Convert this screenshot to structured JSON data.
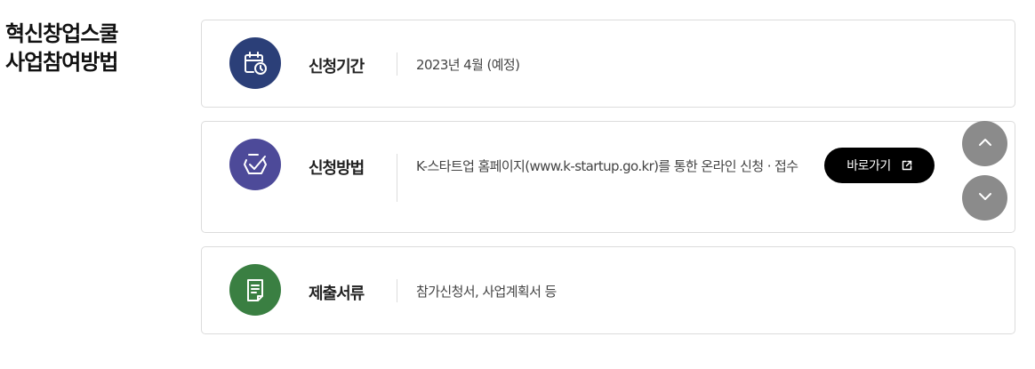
{
  "section_title": "혁신창업스쿨\n사업참여방법",
  "cards": [
    {
      "icon": "calendar-clock-icon",
      "label": "신청기간",
      "content": "2023년 4월 (예정)",
      "icon_bg": "#2b3f78"
    },
    {
      "icon": "check-badge-icon",
      "label": "신청방법",
      "content": "K-스타트업 홈페이지(www.k-startup.go.kr)를 통한 온라인 신청 · 접수",
      "icon_bg": "#4d4a99",
      "button_label": "바로가기",
      "button_icon": "external-link-icon"
    },
    {
      "icon": "document-icon",
      "label": "제출서류",
      "content": "참가신청서, 사업계획서 등",
      "icon_bg": "#3a7f42"
    }
  ],
  "scroll_controls": {
    "up_icon": "chevron-up-icon",
    "down_icon": "chevron-down-icon",
    "bg": "#8b8b8b"
  }
}
